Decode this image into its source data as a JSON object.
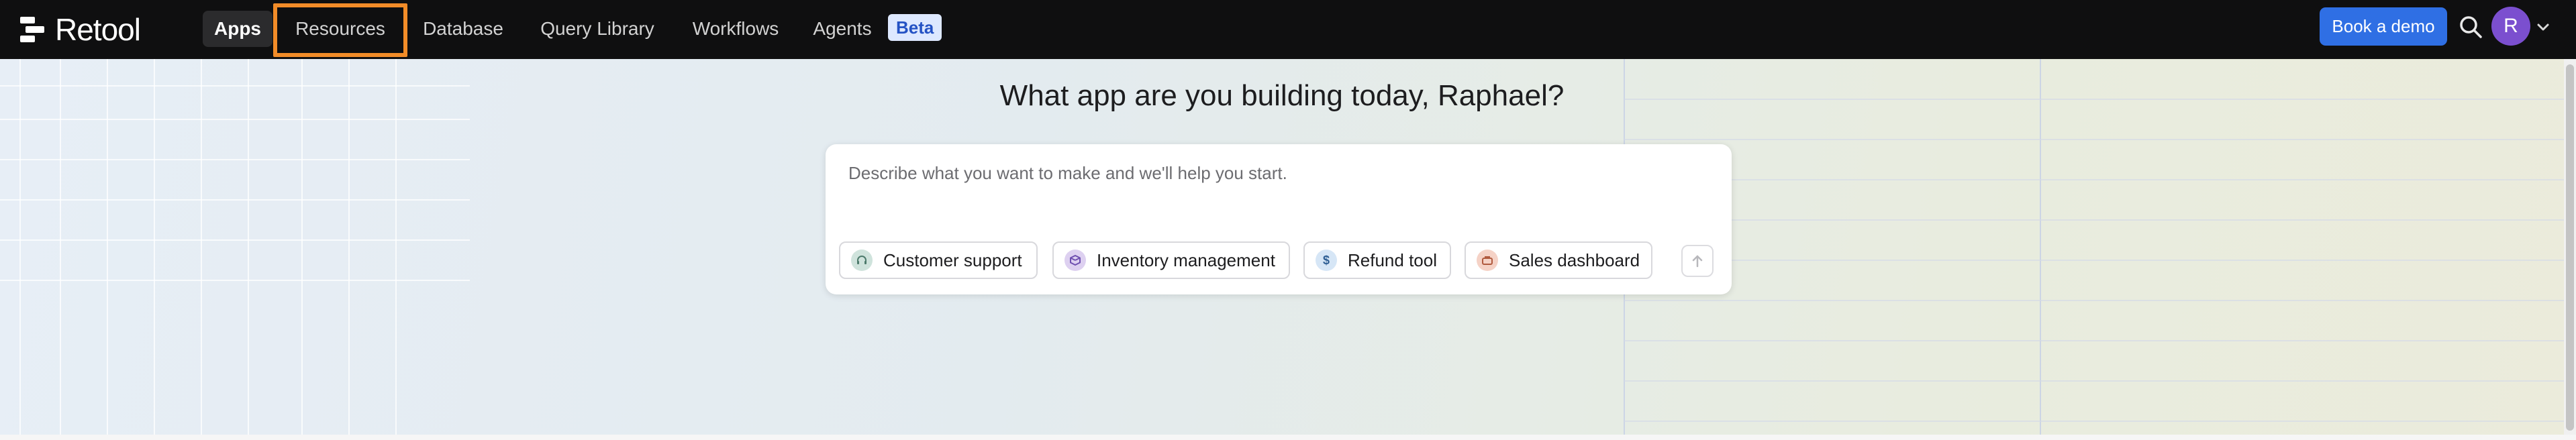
{
  "app": {
    "logo_text": "Retool"
  },
  "nav": {
    "apps": "Apps",
    "resources": "Resources",
    "database": "Database",
    "query_library": "Query Library",
    "workflows": "Workflows",
    "agents": "Agents",
    "agents_badge": "Beta"
  },
  "header": {
    "book_demo": "Book a demo",
    "avatar_initial": "R"
  },
  "main": {
    "headline": "What app are you building today, Raphael?",
    "prompt_placeholder": "Describe what you want to make and we'll help you start.",
    "suggestions": [
      {
        "label": "Customer support",
        "icon": "headset-icon",
        "color": "#cfe3dc"
      },
      {
        "label": "Inventory management",
        "icon": "box-icon",
        "color": "#ddd0f0"
      },
      {
        "label": "Refund tool",
        "icon": "dollar-icon",
        "glyph": "$",
        "color": "#d6e6f6"
      },
      {
        "label": "Sales dashboard",
        "icon": "briefcase-icon",
        "color": "#f5d2c6"
      }
    ]
  },
  "colors": {
    "accent": "#2f6fe4",
    "highlight": "#f28c28",
    "avatar": "#7b4fcf"
  }
}
